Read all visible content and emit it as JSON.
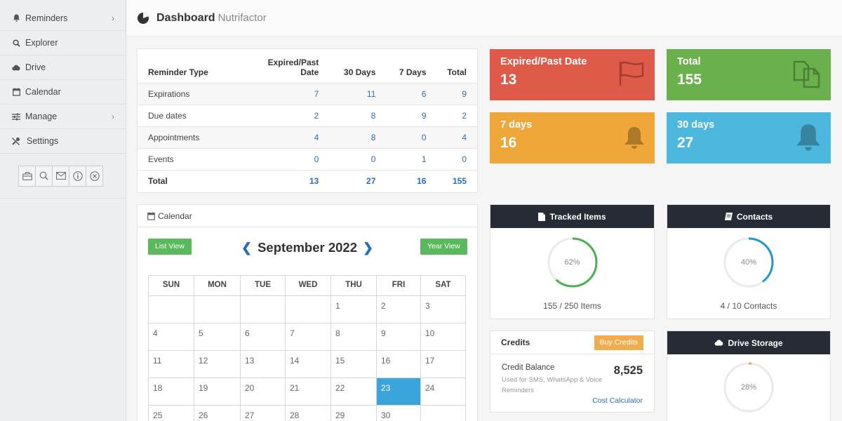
{
  "sidebar": {
    "items": [
      {
        "label": "Reminders",
        "icon": "bell-icon",
        "chevron": "›"
      },
      {
        "label": "Explorer",
        "icon": "search-icon"
      },
      {
        "label": "Drive",
        "icon": "cloud-icon"
      },
      {
        "label": "Calendar",
        "icon": "calendar-icon"
      },
      {
        "label": "Manage",
        "icon": "sliders-icon",
        "chevron": "›"
      },
      {
        "label": "Settings",
        "icon": "tools-icon"
      }
    ],
    "tools": [
      "briefcase-icon",
      "search-icon",
      "mail-icon",
      "info-icon",
      "close-circle-icon"
    ]
  },
  "header": {
    "title": "Dashboard",
    "subtitle": "Nutrifactor"
  },
  "reminder_table": {
    "headers": [
      "Reminder Type",
      "Expired/Past Date",
      "30 Days",
      "7 Days",
      "Total"
    ],
    "header_expired_line1": "Expired/Past",
    "header_expired_line2": "Date",
    "rows": [
      {
        "type": "Expirations",
        "expired": "7",
        "d30": "11",
        "d7": "6",
        "total": "9"
      },
      {
        "type": "Due dates",
        "expired": "2",
        "d30": "8",
        "d7": "9",
        "total": "2"
      },
      {
        "type": "Appointments",
        "expired": "4",
        "d30": "8",
        "d7": "0",
        "total": "4"
      },
      {
        "type": "Events",
        "expired": "0",
        "d30": "0",
        "d7": "1",
        "total": "0"
      },
      {
        "type": "Total",
        "expired": "13",
        "d30": "27",
        "d7": "16",
        "total": "155"
      }
    ]
  },
  "tiles": {
    "expired": {
      "label": "Expired/Past Date",
      "value": "13",
      "color": "#df5a49",
      "icon": "flag-icon"
    },
    "total": {
      "label": "Total",
      "value": "155",
      "color": "#6ab04c",
      "icon": "copy-icon"
    },
    "days7": {
      "label": "7 days",
      "value": "16",
      "color": "#f0a73a",
      "icon": "bell-icon"
    },
    "days30": {
      "label": "30 days",
      "value": "27",
      "color": "#4db8dd",
      "icon": "bell-icon"
    }
  },
  "calendar": {
    "header": "Calendar",
    "list_view": "List View",
    "year_view": "Year View",
    "month": "September 2022",
    "prev": "❮",
    "next": "❯",
    "weekdays": [
      "SUN",
      "MON",
      "TUE",
      "WED",
      "THU",
      "FRI",
      "SAT"
    ],
    "weeks": [
      [
        "",
        "",
        "",
        "",
        "1",
        "2",
        "3"
      ],
      [
        "4",
        "5",
        "6",
        "7",
        "8",
        "9",
        "10"
      ],
      [
        "11",
        "12",
        "13",
        "14",
        "15",
        "16",
        "17"
      ],
      [
        "18",
        "19",
        "20",
        "21",
        "22",
        "23",
        "24"
      ],
      [
        "25",
        "26",
        "27",
        "28",
        "29",
        "30",
        ""
      ]
    ],
    "today": "23"
  },
  "tracked": {
    "title": "Tracked Items",
    "percent": 62,
    "percent_label": "62%",
    "caption": "155 / 250 Items",
    "color": "#4caf50"
  },
  "contacts": {
    "title": "Contacts",
    "percent": 40,
    "percent_label": "40%",
    "caption": "4 / 10 Contacts",
    "color": "#2196d3"
  },
  "storage": {
    "title": "Drive Storage",
    "percent": 28,
    "percent_label": "28%",
    "color": "#f0a73a"
  },
  "credits": {
    "title": "Credits",
    "buy": "Buy Credits",
    "balance_label": "Credit Balance",
    "balance_desc": "Used for SMS, WhatsApp & Voice Reminders",
    "balance_value": "8,525",
    "calculator": "Cost Calculator"
  }
}
